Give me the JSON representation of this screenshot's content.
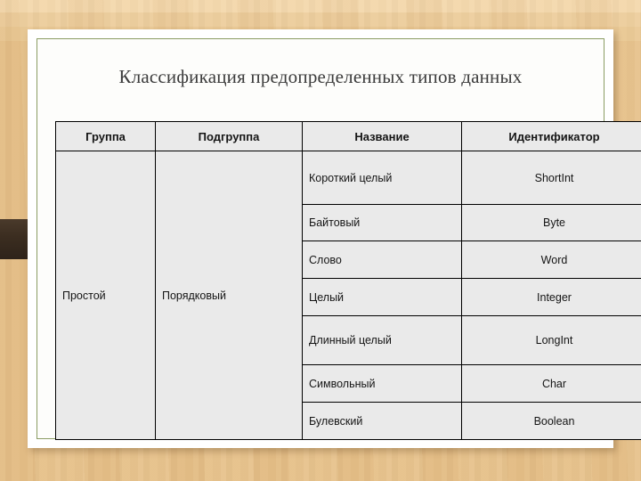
{
  "slide": {
    "title": "Классификация предопределенных типов данных",
    "background_color": "#e6c089",
    "card_color": "#ffffff",
    "frame_border_color": "#8b9c63",
    "rod_color": "#3b2d20",
    "table_cell_color": "#eaeaea",
    "table_border_color": "#000000"
  },
  "table": {
    "columns": [
      {
        "key": "group",
        "label": "Группа"
      },
      {
        "key": "subgroup",
        "label": "Подгруппа"
      },
      {
        "key": "name",
        "label": "Название"
      },
      {
        "key": "ident",
        "label": "Идентификатор"
      }
    ],
    "rows": [
      {
        "group": "Простой",
        "subgroup": "Порядковый",
        "name": "Короткий целый",
        "ident": "ShortInt"
      },
      {
        "group": "",
        "subgroup": "",
        "name": "Байтовый",
        "ident": "Byte"
      },
      {
        "group": "",
        "subgroup": "",
        "name": "Слово",
        "ident": "Word"
      },
      {
        "group": "",
        "subgroup": "",
        "name": "Целый",
        "ident": "Integer"
      },
      {
        "group": "",
        "subgroup": "",
        "name": "Длинный целый",
        "ident": "LongInt"
      },
      {
        "group": "",
        "subgroup": "",
        "name": "Символьный",
        "ident": "Char"
      },
      {
        "group": "",
        "subgroup": "",
        "name": "Булевский",
        "ident": "Boolean"
      }
    ]
  }
}
